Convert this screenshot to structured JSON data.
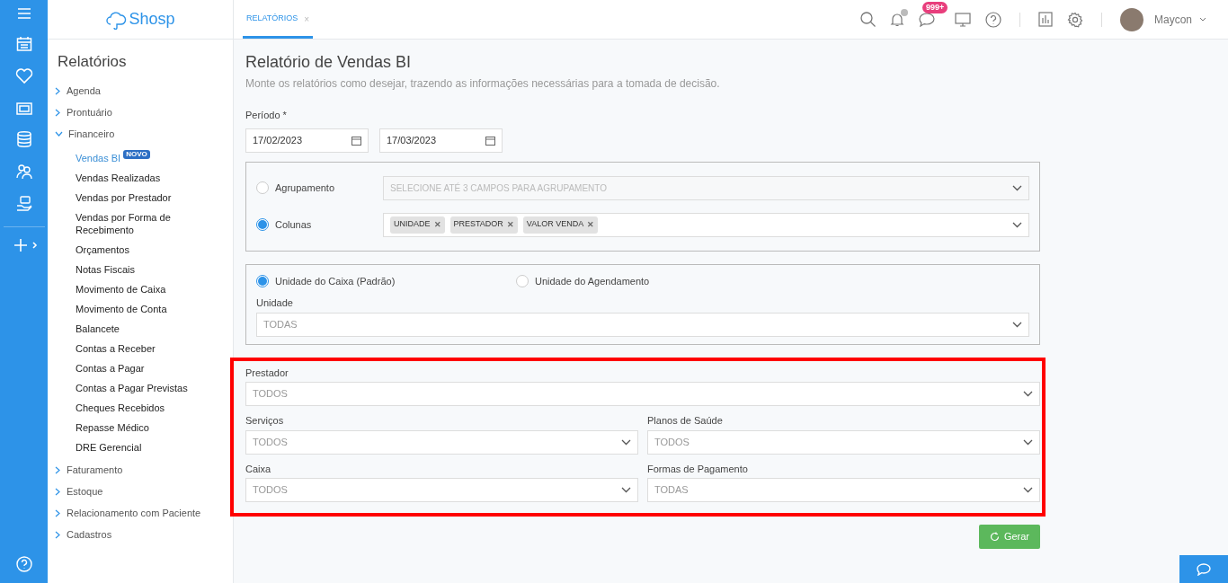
{
  "logo": {
    "text": "Shosp"
  },
  "sidebar": {
    "title": "Relatórios",
    "groups": [
      {
        "label": "Agenda",
        "expanded": false
      },
      {
        "label": "Prontuário",
        "expanded": false
      },
      {
        "label": "Financeiro",
        "expanded": true,
        "children": [
          {
            "label": "Vendas BI",
            "selected": true,
            "badge": "NOVO"
          },
          {
            "label": "Vendas Realizadas",
            "selected": false
          },
          {
            "label": "Vendas por Prestador",
            "selected": false
          },
          {
            "label": "Vendas por Forma de Recebimento",
            "selected": false
          },
          {
            "label": "Orçamentos",
            "selected": false
          },
          {
            "label": "Notas Fiscais",
            "selected": false
          },
          {
            "label": "Movimento de Caixa",
            "selected": false
          },
          {
            "label": "Movimento de Conta",
            "selected": false
          },
          {
            "label": "Balancete",
            "selected": false
          },
          {
            "label": "Contas a Receber",
            "selected": false
          },
          {
            "label": "Contas a Pagar",
            "selected": false
          },
          {
            "label": "Contas a Pagar Previstas",
            "selected": false
          },
          {
            "label": "Cheques Recebidos",
            "selected": false
          },
          {
            "label": "Repasse Médico",
            "selected": false
          },
          {
            "label": "DRE Gerencial",
            "selected": false
          }
        ]
      },
      {
        "label": "Faturamento",
        "expanded": false
      },
      {
        "label": "Estoque",
        "expanded": false
      },
      {
        "label": "Relacionamento com Paciente",
        "expanded": false
      },
      {
        "label": "Cadastros",
        "expanded": false
      }
    ]
  },
  "tabs": [
    {
      "label": "RELATÓRIOS",
      "selected": true,
      "close": "×"
    }
  ],
  "topbar": {
    "messages_badge": "999+",
    "user": "Maycon"
  },
  "page": {
    "title": "Relatório de Vendas BI",
    "subtitle": "Monte os relatórios como desejar, trazendo as informações necessárias para a tomada de decisão.",
    "period": {
      "label": "Período *",
      "from": "17/02/2023",
      "to": "17/03/2023"
    },
    "mode": [
      {
        "label": "Agrupamento",
        "selected": false,
        "placeholder": "SELECIONE ATÉ 3 CAMPOS PARA AGRUPAMENTO"
      },
      {
        "label": "Colunas",
        "selected": true,
        "tags": [
          {
            "label": "UNIDADE",
            "remove": "✕"
          },
          {
            "label": "PRESTADOR",
            "remove": "✕"
          },
          {
            "label": "VALOR VENDA",
            "remove": "✕"
          }
        ]
      }
    ],
    "unit_source": [
      {
        "label": "Unidade do Caixa (Padrão)",
        "selected": true
      },
      {
        "label": "Unidade do Agendamento",
        "selected": false
      }
    ],
    "unit": {
      "label": "Unidade",
      "value": "TODAS"
    },
    "filters": [
      {
        "label": "Prestador",
        "value": "TODOS",
        "kind": "wide"
      },
      {
        "label": "Serviços",
        "value": "TODOS",
        "kind": "half"
      },
      {
        "label": "Planos de Saúde",
        "value": "TODOS",
        "kind": "half"
      },
      {
        "label": "Caixa",
        "value": "TODOS",
        "kind": "half"
      },
      {
        "label": "Formas de Pagamento",
        "value": "TODAS",
        "kind": "half"
      }
    ],
    "generate": "Gerar"
  }
}
